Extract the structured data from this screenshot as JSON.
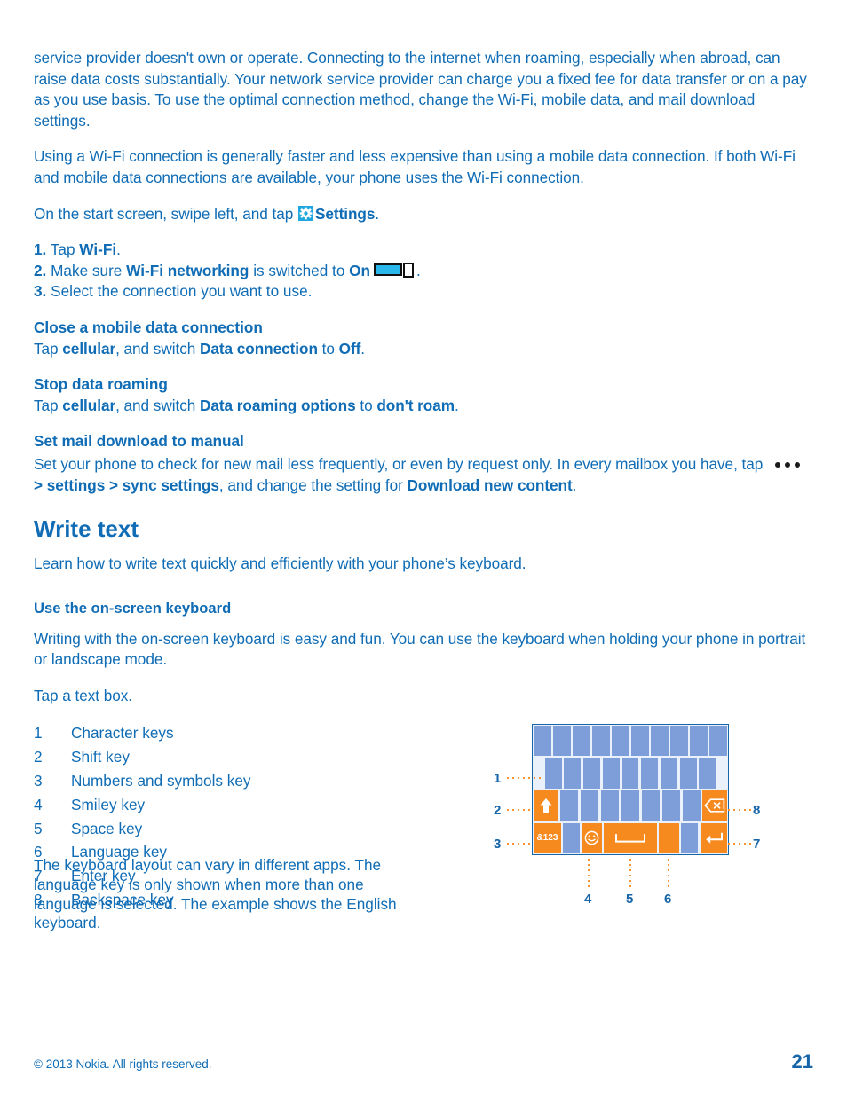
{
  "document": {
    "paragraphs": {
      "p1_part1": "service provider doesn't own or operate. Connecting to the internet when roaming, especially when abroad, can raise data costs substantially. Your network service provider can charge you a fixed fee for data transfer or on a pay as you use basis. To use the optimal connection method, change the Wi-Fi, mobile data, and mail download settings.",
      "p2": "Using a Wi-Fi connection is generally faster and less expensive than using a mobile data connection. If both Wi-Fi and mobile data connections are available, your phone uses the Wi-Fi connection."
    },
    "settings_line": {
      "prefix": "On the start screen, swipe left, and tap ",
      "icon": "settings-gear-icon",
      "bold": "Settings",
      "suffix": "."
    },
    "steps": [
      {
        "num": "1.",
        "pre": " Tap ",
        "bold": "Wi-Fi",
        "post": "."
      },
      {
        "num": "2.",
        "pre": " Make sure ",
        "bold": "Wi-Fi networking",
        "mid": " is switched to ",
        "bold2": "On",
        "post": "."
      },
      {
        "num": "3.",
        "pre": " Select the connection you want to use.",
        "bold": "",
        "post": ""
      }
    ],
    "tasks": [
      {
        "heading": "Close a mobile data connection",
        "pre": "Tap ",
        "bold1": "cellular",
        "mid1": ", and switch ",
        "bold2": "Data connection",
        "mid2": " to ",
        "bold3": "Off",
        "post": "."
      },
      {
        "heading": "Stop data roaming",
        "pre": "Tap ",
        "bold1": "cellular",
        "mid1": ", and switch ",
        "bold2": "Data roaming options",
        "mid2": " to ",
        "bold3": "don't roam",
        "post": "."
      }
    ],
    "mail_task": {
      "heading": "Set mail download to manual",
      "pre": "Set your phone to check for new mail less frequently, or even by request only. In every mailbox you have, tap ",
      "icon": "ellipsis-icon",
      "sep1": " > ",
      "bold1": "settings",
      "sep2": " > ",
      "bold2": "sync settings",
      "mid": ", and change the setting for ",
      "bold3": "Download new content",
      "post": "."
    },
    "write_text": {
      "title": "Write text",
      "intro": "Learn how to write text quickly and efficiently with your phone’s keyboard.",
      "subtitle": "Use the on-screen keyboard",
      "body1": "Writing with the on-screen keyboard is easy and fun. You can use the keyboard when holding your phone in portrait or landscape mode.",
      "body2": "Tap a text box."
    },
    "legend": [
      {
        "num": "1",
        "label": "Character keys"
      },
      {
        "num": "2",
        "label": "Shift key"
      },
      {
        "num": "3",
        "label": "Numbers and symbols key"
      },
      {
        "num": "4",
        "label": "Smiley key"
      },
      {
        "num": "5",
        "label": "Space key"
      },
      {
        "num": "6",
        "label": "Language key"
      },
      {
        "num": "7",
        "label": "Enter key"
      },
      {
        "num": "8",
        "label": "Backspace key"
      }
    ],
    "note": "The keyboard layout can vary in different apps. The language key is only shown when more than one language is selected. The example shows the English keyboard.",
    "footer": {
      "copyright": "© 2013 Nokia. All rights reserved.",
      "page_number": "21"
    }
  },
  "figure": {
    "name": "on-screen-keyboard-diagram",
    "callouts": {
      "c1": "1",
      "c2": "2",
      "c3": "3",
      "c4": "4",
      "c5": "5",
      "c6": "6",
      "c7": "7",
      "c8": "8"
    },
    "keys": {
      "numbers_symbols_label": "&123",
      "shift_label": "shift-up-arrow-icon",
      "smiley_label": "smiley-icon",
      "space_label": "space-bar-icon",
      "enter_label": "enter-arrow-icon",
      "backspace_label": "backspace-icon"
    }
  },
  "colors": {
    "text_blue": "#0f6cb5",
    "accent_blue": "#1565a8",
    "key_blue": "#7d9ed8",
    "key_orange": "#f68a1f",
    "icon_cyan": "#1fa8e0",
    "dot_orange": "#f68a1f"
  }
}
